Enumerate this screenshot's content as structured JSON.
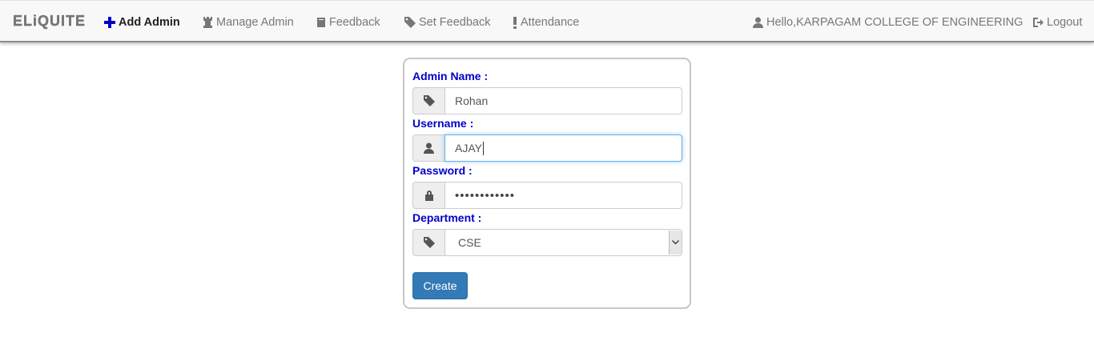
{
  "nav": {
    "brand": "ELiQUITE",
    "items": [
      {
        "label": "Add Admin",
        "icon": "plus-icon"
      },
      {
        "label": "Manage Admin",
        "icon": "tower-icon"
      },
      {
        "label": "Feedback",
        "icon": "book-icon"
      },
      {
        "label": "Set Feedback",
        "icon": "tag-icon"
      },
      {
        "label": "Attendance",
        "icon": "exclamation-icon"
      }
    ],
    "user_greeting": "Hello,KARPAGAM COLLEGE OF ENGINEERING",
    "logout": "Logout",
    "accent": "#0000cc"
  },
  "form": {
    "admin_name_label": "Admin Name :",
    "admin_name_value": "Rohan",
    "username_label": "Username :",
    "username_value": "AJAY",
    "password_label": "Password :",
    "password_mask": "••••••••••••",
    "department_label": "Department :",
    "department_value": "CSE",
    "submit_label": "Create",
    "label_color": "#0000cc",
    "button_color": "#337ab7"
  }
}
